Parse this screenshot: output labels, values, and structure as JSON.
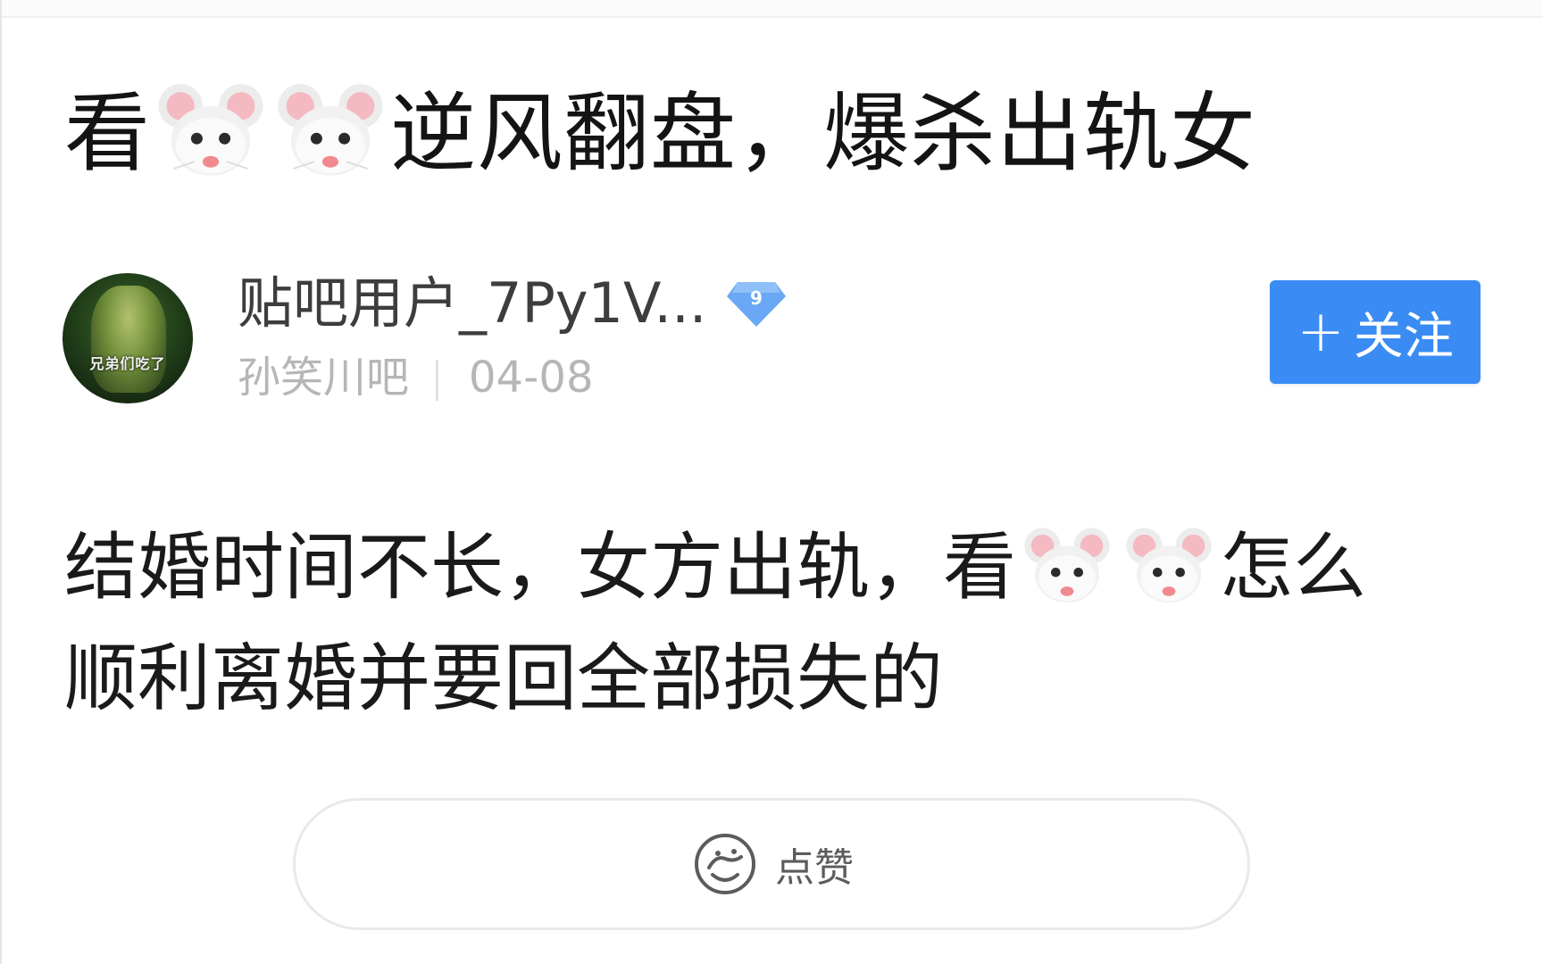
{
  "post": {
    "title_parts": [
      "看",
      "逆风翻盘，爆杀出轨女"
    ],
    "author": {
      "username": "贴吧用户_7Py1V...",
      "level": "9",
      "avatar_caption": "兄弟们吃了",
      "forum": "孙笑川吧",
      "date": "04-08"
    },
    "follow_button": {
      "plus": "+",
      "label": "关注"
    },
    "body": {
      "line1_a": "结婚时间不长，女方出轨，看",
      "line1_b": "怎么",
      "line2": "顺利离婚并要回全部损失的"
    },
    "like_button": {
      "label": "点赞"
    }
  },
  "icons": {
    "mouse": "mouse-face-emoji",
    "like": "thumbs-up-icon",
    "level": "diamond-level-icon"
  },
  "colors": {
    "accent": "#3a8cf4",
    "meta_text": "#b6b6b6",
    "level_badge": "#6aa8f5"
  }
}
